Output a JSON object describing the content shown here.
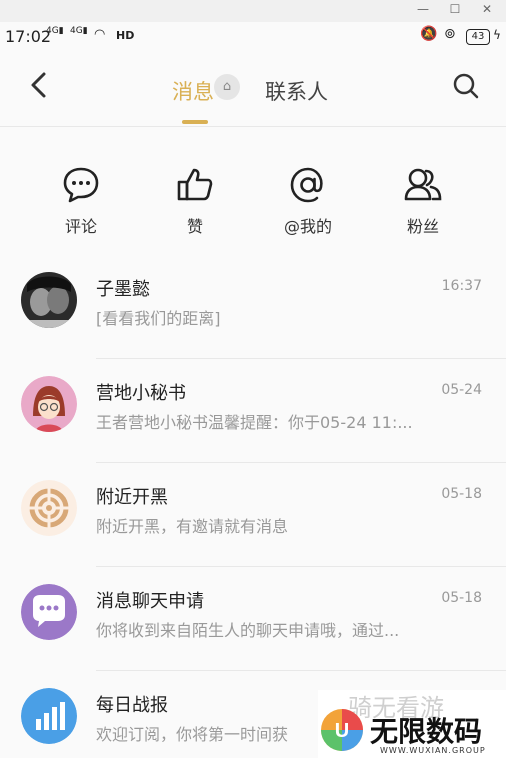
{
  "window": {
    "min_label": "—",
    "max_label": "☐",
    "close_label": "✕"
  },
  "status": {
    "time": "17:02",
    "signal1": "4G",
    "signal2": "4G",
    "hd": "HD",
    "battery": "43"
  },
  "nav": {
    "tab_messages": "消息",
    "tab_contacts": "联系人"
  },
  "quick_actions": [
    {
      "label": "评论",
      "icon": "comment-icon"
    },
    {
      "label": "赞",
      "icon": "thumbs-up-icon"
    },
    {
      "label": "@我的",
      "icon": "at-icon"
    },
    {
      "label": "粉丝",
      "icon": "fans-icon"
    }
  ],
  "messages": [
    {
      "title": "子墨懿",
      "time": "16:37",
      "preview": "[看看我们的距离]"
    },
    {
      "title": "营地小秘书",
      "time": "05-24",
      "preview": "王者营地小秘书温馨提醒：你于05-24 11:..."
    },
    {
      "title": "附近开黑",
      "time": "05-18",
      "preview": "附近开黑，有邀请就有消息"
    },
    {
      "title": "消息聊天申请",
      "time": "05-18",
      "preview": "你将收到来自陌生人的聊天申请哦，通过..."
    },
    {
      "title": "每日战报",
      "time": "",
      "preview": "欢迎订阅，你将第一时间获"
    }
  ],
  "watermark": {
    "faint": "骑无看游",
    "big": "无限数码",
    "small": "WWW.WUXIAN.GROUP"
  },
  "colors": {
    "accent": "#d9b054"
  }
}
